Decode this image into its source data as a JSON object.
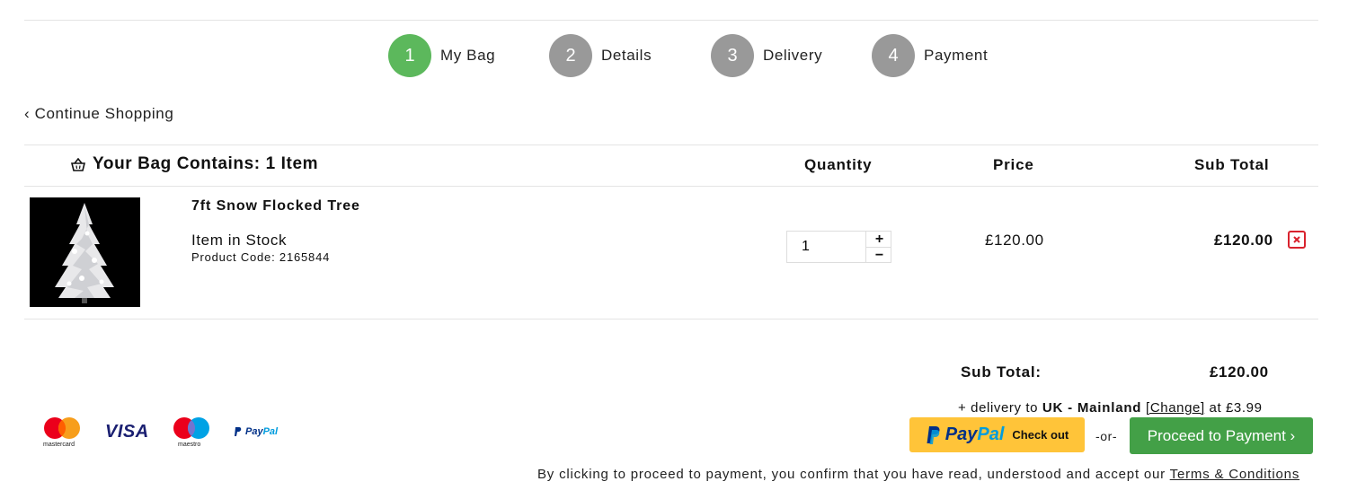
{
  "steps": [
    {
      "number": "1",
      "label": "My Bag",
      "active": true
    },
    {
      "number": "2",
      "label": "Details",
      "active": false
    },
    {
      "number": "3",
      "label": "Delivery",
      "active": false
    },
    {
      "number": "4",
      "label": "Payment",
      "active": false
    }
  ],
  "nav": {
    "continue_shopping": "‹ Continue Shopping"
  },
  "table": {
    "bag_title": "Your Bag Contains: 1 Item",
    "headers": {
      "quantity": "Quantity",
      "price": "Price",
      "subtotal": "Sub Total"
    }
  },
  "item": {
    "name": "7ft Snow Flocked Tree",
    "stock": "Item in Stock",
    "product_code": "Product Code: 2165844",
    "quantity": "1",
    "increment": "+",
    "decrement": "−",
    "price": "£120.00",
    "subtotal": "£120.00"
  },
  "totals": {
    "subtotal_label": "Sub Total:",
    "subtotal_value": "£120.00",
    "delivery_prefix": "+ delivery to ",
    "delivery_region": "UK - Mainland",
    "change_link": "[Change]",
    "delivery_suffix": " at £3.99"
  },
  "checkout": {
    "paypal_pay": "Pay",
    "paypal_pal": "Pal",
    "paypal_checkout": "Check out",
    "or": "-or-",
    "proceed": "Proceed to Payment ›"
  },
  "terms": {
    "text": "By clicking to proceed to payment, you confirm that you have read, understood and accept our ",
    "link": "Terms & Conditions"
  },
  "payment_logos": {
    "mastercard": "mastercard",
    "visa": "VISA",
    "maestro": "maestro",
    "paypal_pay": "Pay",
    "paypal_pal": "Pal"
  },
  "colors": {
    "active_step": "#5cb85c",
    "inactive_step": "#999999",
    "proceed_button": "#43a047",
    "paypal_button": "#ffc439",
    "remove": "#d9232e"
  }
}
